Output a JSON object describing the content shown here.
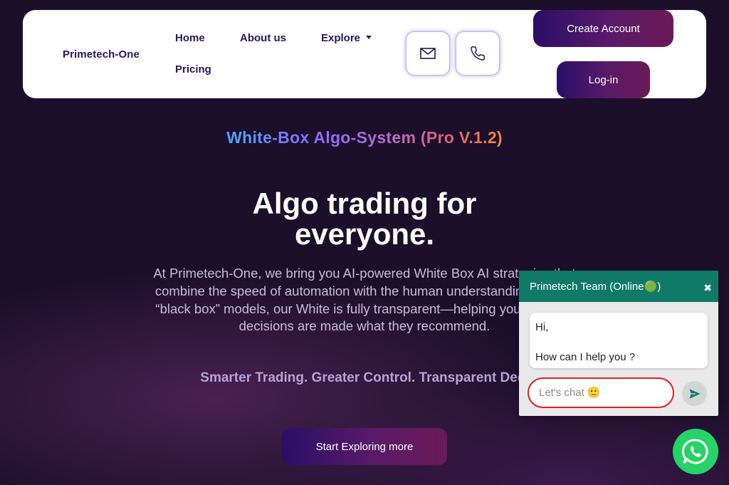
{
  "nav": {
    "brand": "Primetech-One",
    "links": {
      "home": "Home",
      "about": "About us",
      "explore": "Explore",
      "pricing": "Pricing"
    },
    "create_account": "Create Account",
    "login": "Log-in"
  },
  "hero": {
    "tagline": "White-Box Algo-System (Pro V.1.2)",
    "headline_line1": "Algo trading for",
    "headline_line2": "everyone.",
    "description": "At Primetech-One, we bring you AI-powered White Box AI strategies that combine the speed of automation with the human understanding. Unlike “black box” models, our White is fully transparent—helping you see how decisions are made what they recommend.",
    "subline": "Smarter Trading. Greater Control. Transparent Deci",
    "cta": "Start Exploring more"
  },
  "chat": {
    "title": "Primetech Team (Online🟢)",
    "greeting": "Hi,",
    "question": "How can I help you ?",
    "input_placeholder": "Let's chat 🙂"
  },
  "colors": {
    "nav_text": "#2a1655",
    "chat_header": "#0f7a67",
    "whatsapp": "#25d366",
    "page_bg": "#1b0f2b"
  },
  "icons": [
    "mail-icon",
    "phone-icon",
    "close-icon",
    "send-icon",
    "whatsapp-icon"
  ]
}
